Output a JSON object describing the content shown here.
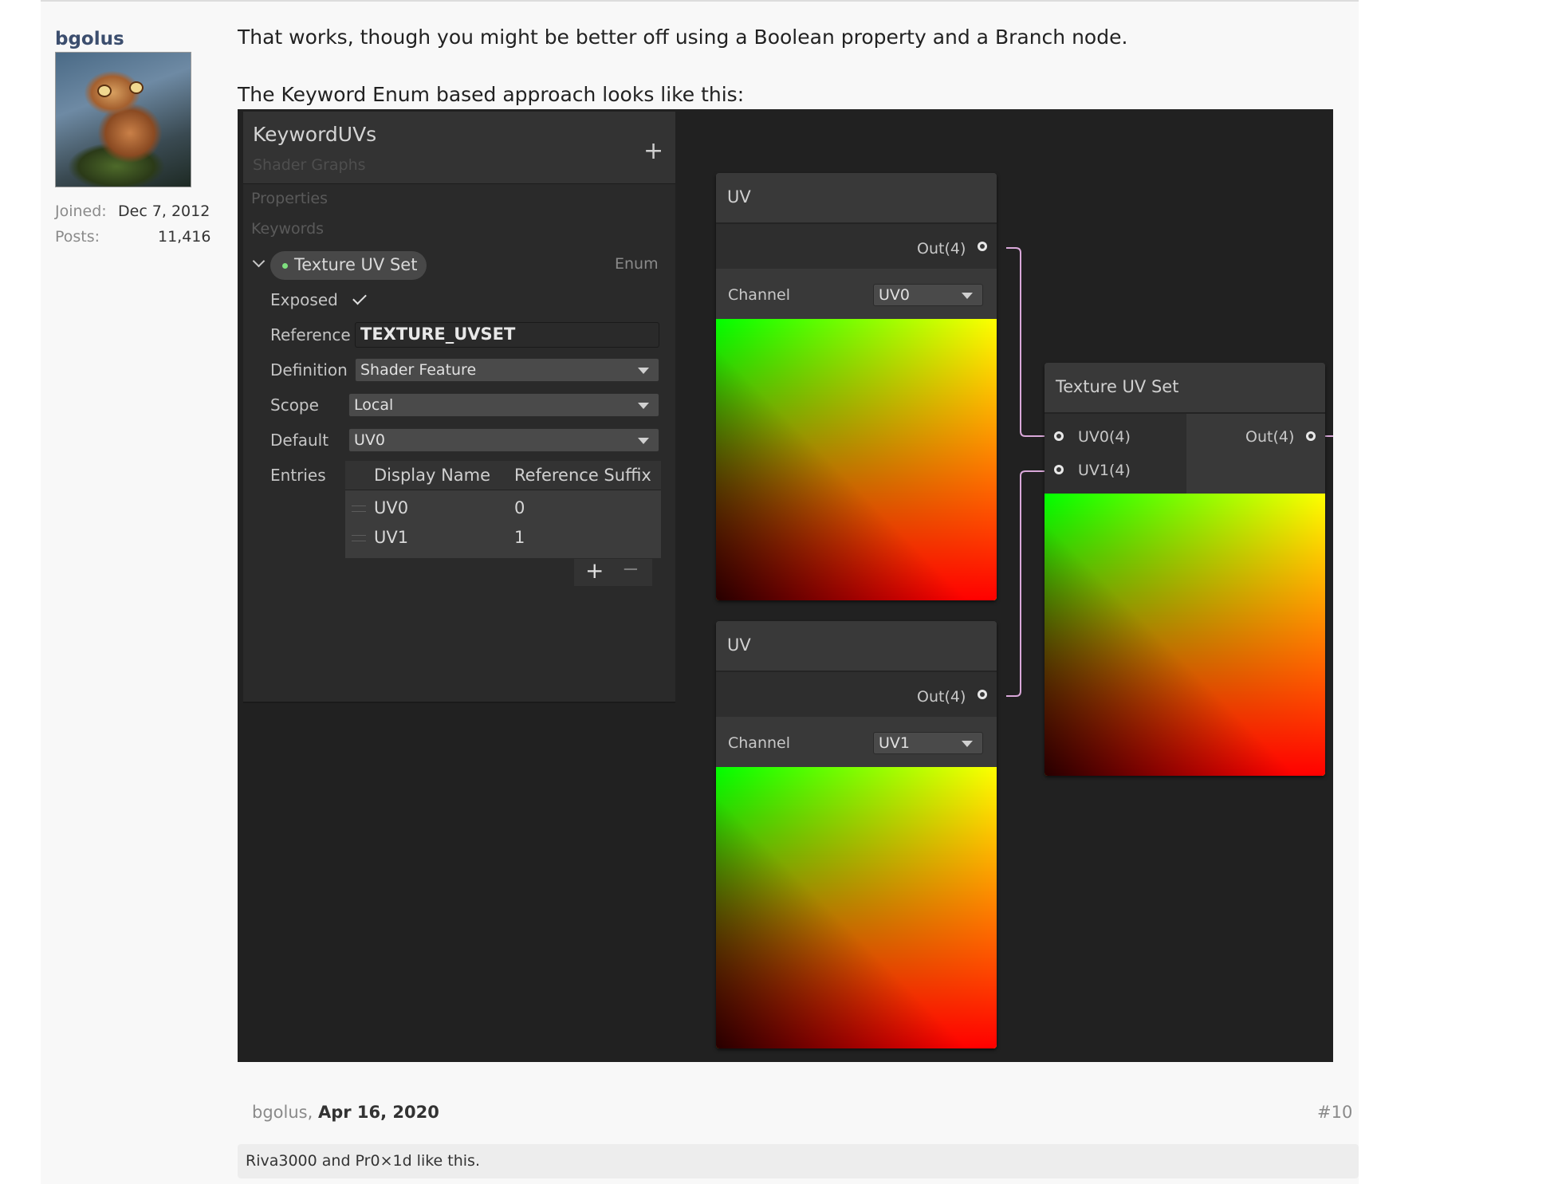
{
  "user": {
    "name": "bgolus",
    "joined_label": "Joined:",
    "joined_value": "Dec 7, 2012",
    "posts_label": "Posts:",
    "posts_value": "11,416"
  },
  "message": {
    "line1": "That works, though you might be better off using a Boolean property and a Branch node.",
    "line2": "The Keyword Enum based approach looks like this:"
  },
  "blackboard": {
    "title": "KeywordUVs",
    "subtitle": "Shader Graphs",
    "add_symbol": "+",
    "properties_label": "Properties",
    "keywords_label": "Keywords",
    "keyword_name": "Texture UV Set",
    "keyword_type": "Enum",
    "exposed_label": "Exposed",
    "reference_label": "Reference",
    "reference_value": "TEXTURE_UVSET",
    "definition_label": "Definition",
    "definition_value": "Shader Feature",
    "scope_label": "Scope",
    "scope_value": "Local",
    "default_label": "Default",
    "default_value": "UV0",
    "entries_label": "Entries",
    "col_display": "Display Name",
    "col_suffix": "Reference Suffix",
    "entries": [
      {
        "name": "UV0",
        "suffix": "0"
      },
      {
        "name": "UV1",
        "suffix": "1"
      }
    ],
    "plus": "+",
    "minus": "−"
  },
  "nodes": {
    "uv_a": {
      "title": "UV",
      "out": "Out(4)",
      "channel_label": "Channel",
      "channel_value": "UV0"
    },
    "uv_b": {
      "title": "UV",
      "out": "Out(4)",
      "channel_label": "Channel",
      "channel_value": "UV1"
    },
    "keyword": {
      "title": "Texture UV Set",
      "in0": "UV0(4)",
      "in1": "UV1(4)",
      "out": "Out(4)"
    }
  },
  "colors": {
    "wire": "#d9a8d9",
    "gradient_green": "#00ff00",
    "gradient_yellow": "#ffff00",
    "gradient_red": "#ff0000"
  },
  "footer": {
    "author": "bgolus,",
    "date": "Apr 16, 2020",
    "post_number": "#10",
    "likes": "Riva3000 and Pr0×1d like this."
  }
}
